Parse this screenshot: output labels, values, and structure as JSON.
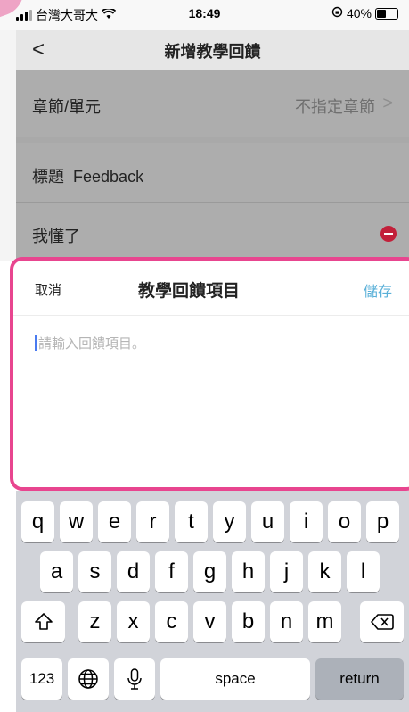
{
  "status": {
    "carrier": "台灣大哥大",
    "time": "18:49",
    "battery": "40%"
  },
  "nav": {
    "back": "<",
    "title": "新增教學回饋"
  },
  "rows": {
    "chapter_label": "章節/單元",
    "chapter_value": "不指定章節",
    "chevron": ">",
    "title_label": "標題",
    "title_value": "Feedback",
    "understood_label": "我懂了"
  },
  "sheet": {
    "cancel": "取消",
    "title": "教學回饋項目",
    "save": "儲存",
    "placeholder": "請輸入回饋項目。"
  },
  "keyboard": {
    "row1": [
      "q",
      "w",
      "e",
      "r",
      "t",
      "y",
      "u",
      "i",
      "o",
      "p"
    ],
    "row2": [
      "a",
      "s",
      "d",
      "f",
      "g",
      "h",
      "j",
      "k",
      "l"
    ],
    "row3": [
      "z",
      "x",
      "c",
      "v",
      "b",
      "n",
      "m"
    ],
    "numbers": "123",
    "space": "space",
    "return": "return"
  },
  "colors": {
    "highlight": "#e8458f",
    "save": "#5ab0d8",
    "delete": "#c2203a"
  }
}
